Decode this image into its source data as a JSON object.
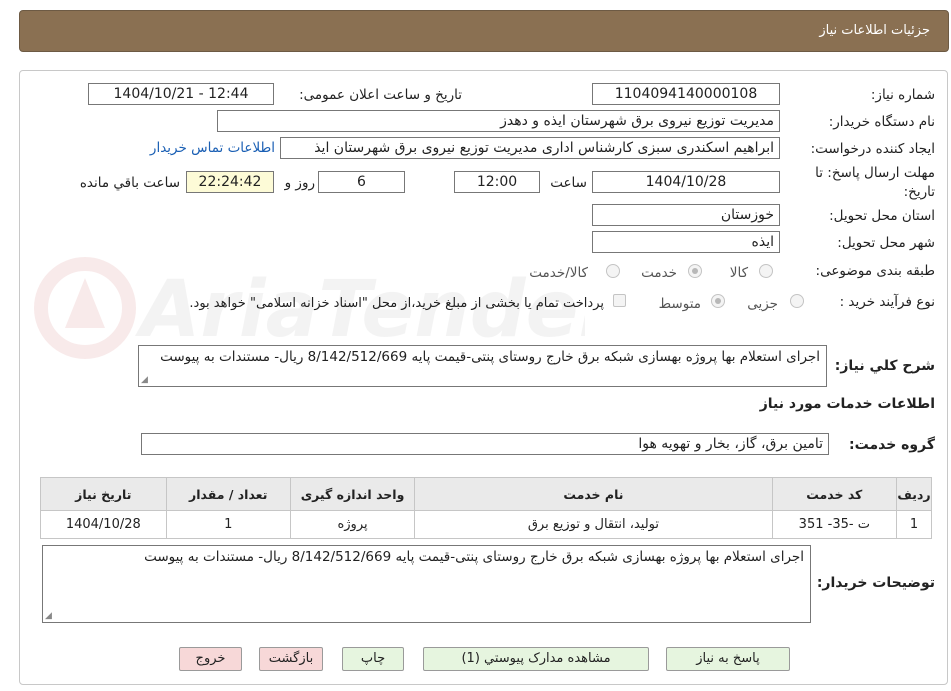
{
  "header": {
    "title": "جزئیات اطلاعات نیاز"
  },
  "form": {
    "need_number": {
      "label": "شماره نیاز:",
      "value": "1104094140000108"
    },
    "announce": {
      "label": "تاریخ و ساعت اعلان عمومی:",
      "value": "1404/10/21 - 12:44"
    },
    "buyer_org": {
      "label": "نام دستگاه خریدار:",
      "value": "مدیریت توزیع نیروی برق شهرستان ایذه و دهدز"
    },
    "requester": {
      "label": "ایجاد کننده درخواست:",
      "value": "ابراهیم اسکندری سبزی کارشناس اداری مدیریت توزیع نیروی برق شهرستان ایذ",
      "contact_link": "اطلاعات تماس خریدار"
    },
    "deadline": {
      "label_line1": "مهلت ارسال پاسخ: تا",
      "label_line2": "تاریخ:",
      "date": "1404/10/28",
      "time_label": "ساعت",
      "time": "12:00",
      "days": "6",
      "days_label": "روز و",
      "remaining": "22:24:42",
      "remaining_label": "ساعت باقي مانده"
    },
    "province": {
      "label": "استان محل تحویل:",
      "value": "خوزستان"
    },
    "city": {
      "label": "شهر محل تحویل:",
      "value": "ایذه"
    },
    "category": {
      "label": "طبقه بندی موضوعی:",
      "options": [
        "کالا",
        "خدمت",
        "کالا/خدمت"
      ],
      "selected": "خدمت"
    },
    "process": {
      "label": "نوع فرآیند خرید :",
      "options": [
        "جزیی",
        "متوسط"
      ],
      "selected": "متوسط",
      "note": "پرداخت تمام یا بخشی از مبلغ خرید،از محل \"اسناد خزانه اسلامی\" خواهد بود."
    },
    "summary": {
      "label": "شرح کلي نياز:",
      "value": "اجرای استعلام بها پروژه بهسازی شبکه برق خارج روستای پنتی-قیمت پایه 8/142/512/669 ریال- مستندات به پیوست"
    }
  },
  "services": {
    "section_title": "اطلاعات خدمات مورد نياز",
    "group_label": "گروه خدمت:",
    "group_value": "تامین برق، گاز، بخار و تهویه هوا",
    "columns": [
      "رديف",
      "کد خدمت",
      "نام خدمت",
      "واحد اندازه گیری",
      "تعداد / مقدار",
      "تاريخ نياز"
    ],
    "rows": [
      [
        "1",
        "ت -35- 351",
        "تولید، انتقال و توزیع برق",
        "پروژه",
        "1",
        "1404/10/28"
      ]
    ]
  },
  "buyer_notes": {
    "label": "توضیحات خریدار:",
    "value": "اجرای استعلام بها پروژه بهسازی شبکه برق خارج روستای پنتی-قیمت پایه 8/142/512/669 ریال- مستندات به پیوست"
  },
  "buttons": {
    "reply": "پاسخ به نیاز",
    "attachments": "مشاهده مدارک پیوستي (1)",
    "print": "چاپ",
    "back": "بازگشت",
    "exit": "خروج"
  },
  "watermark": {
    "text": "AriaTender.neT"
  },
  "colors": {
    "header_bg": "#8a7052",
    "link": "#1a5fb4",
    "button_green": "#e6f5df",
    "button_pink": "#f7d8d8",
    "highlight_field": "#fdfbd7"
  }
}
